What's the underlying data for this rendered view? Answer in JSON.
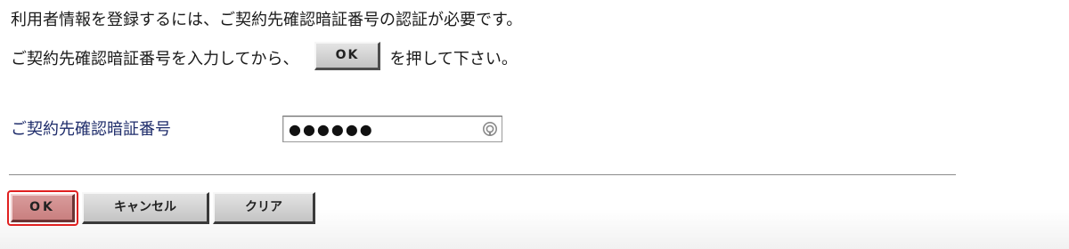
{
  "instructions": {
    "line1": "利用者情報を登録するには、ご契約先確認暗証番号の認証が必要です。",
    "line2_before": "ご契約先確認暗証番号を入力してから、",
    "inline_ok_label": "OK",
    "line2_after": "を押して下さい。"
  },
  "pin_field": {
    "label": "ご契約先確認暗証番号",
    "value": "●●●●●●",
    "icon": "password-reveal-icon"
  },
  "buttons": {
    "ok_label": "OK",
    "cancel_label": "キャンセル",
    "clear_label": "クリア",
    "focused": "ok"
  },
  "colors": {
    "label_text": "#1f2d6b",
    "focus_ring": "#e02020",
    "ok_button_fill": "#d08c8c"
  }
}
